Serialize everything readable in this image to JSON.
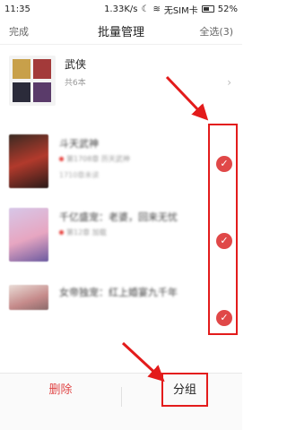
{
  "status_bar": {
    "time": "11:35",
    "speed": "1.33K/s",
    "sim": "无SIM卡",
    "battery": "52%"
  },
  "header": {
    "left_label": "完成",
    "title": "批量管理",
    "right_label": "全选(3)"
  },
  "group": {
    "name": "武侠",
    "count": "共6本"
  },
  "books": [
    {
      "title": "斗天武神",
      "meta": "第1708章 历天武神",
      "extra": "1710章未读"
    },
    {
      "title": "千亿盛宠：老婆，回来无忧",
      "meta": "第12章 加载",
      "extra": ""
    },
    {
      "title": "女帝独宠：红上婚宴九千年",
      "meta": "",
      "extra": ""
    }
  ],
  "bottom_bar": {
    "delete_label": "删除",
    "group_label": "分组"
  },
  "colors": {
    "accent": "#e04848",
    "annotation": "#e31b1b"
  }
}
